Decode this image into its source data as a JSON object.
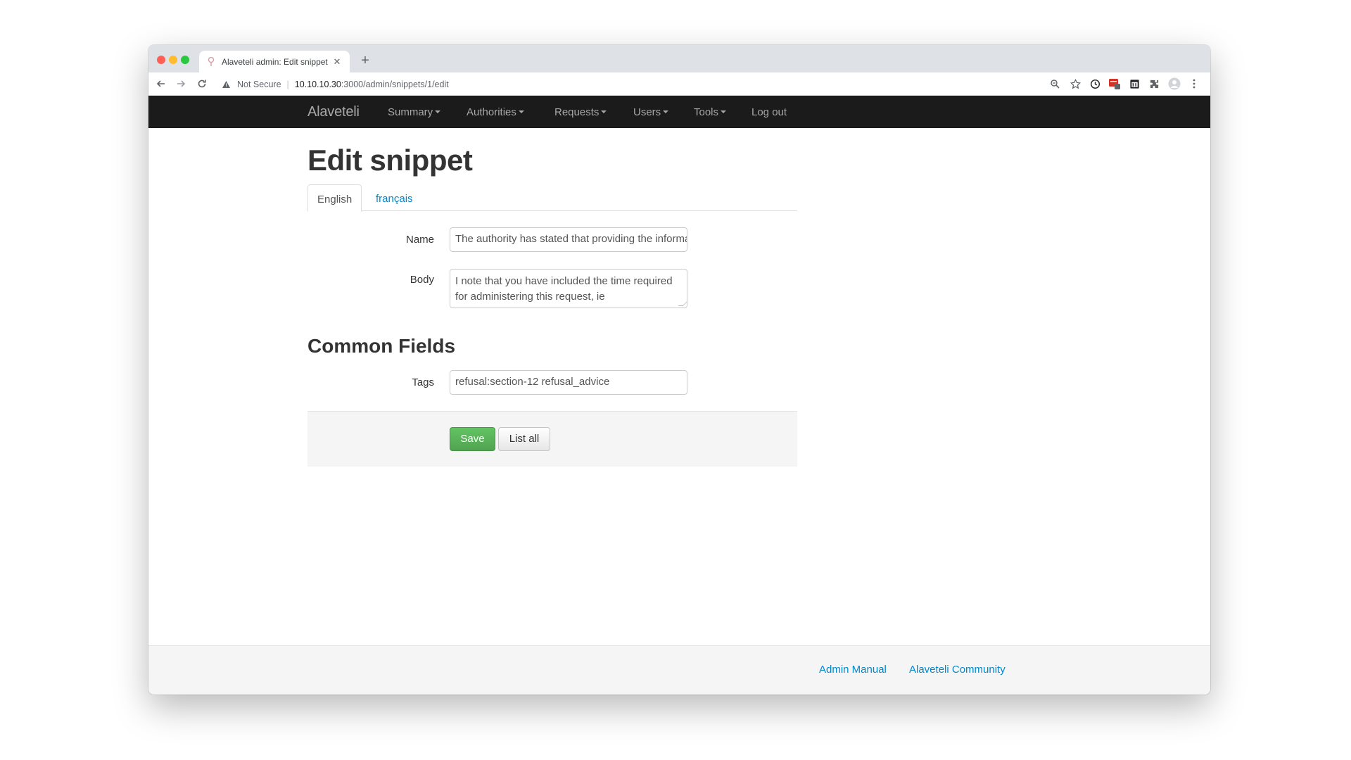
{
  "browser": {
    "tab_title": "Alaveteli admin: Edit snippet",
    "new_tab_symbol": "+",
    "close_symbol": "✕",
    "security_label": "Not Secure",
    "url_host": "10.10.10.30",
    "url_path": ":3000/admin/snippets/1/edit"
  },
  "navbar": {
    "brand": "Alaveteli",
    "items": [
      {
        "label": "Summary",
        "dropdown": true
      },
      {
        "label": "Authorities",
        "dropdown": true
      },
      {
        "label": "Requests",
        "dropdown": true
      },
      {
        "label": "Users",
        "dropdown": true
      },
      {
        "label": "Tools",
        "dropdown": true
      },
      {
        "label": "Log out",
        "dropdown": false
      }
    ]
  },
  "page": {
    "title": "Edit snippet",
    "language_tabs": [
      {
        "label": "English",
        "active": true
      },
      {
        "label": "français",
        "active": false
      }
    ],
    "form": {
      "name_label": "Name",
      "name_value": "The authority has stated that providing the information",
      "body_label": "Body",
      "body_value": "I note that you have included the time required for administering this request, ie",
      "common_fields_title": "Common Fields",
      "tags_label": "Tags",
      "tags_value": "refusal:section-12 refusal_advice"
    },
    "actions": {
      "save_label": "Save",
      "list_all_label": "List all"
    }
  },
  "footer": {
    "links": [
      "Admin Manual",
      "Alaveteli Community"
    ]
  },
  "colors": {
    "navbar_bg": "#1b1b1b",
    "link": "#0088cc",
    "save_button": "#5bb75b"
  }
}
